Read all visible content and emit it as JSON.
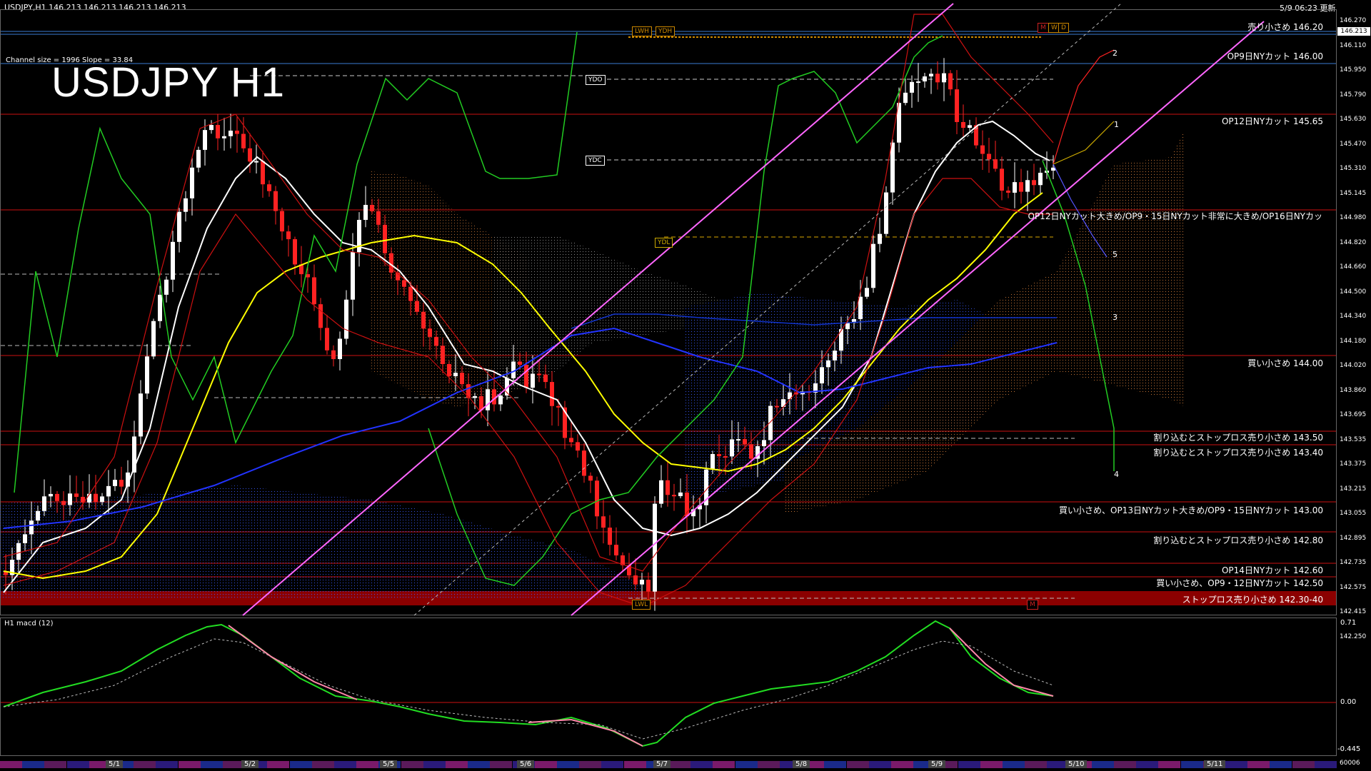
{
  "header": {
    "symbol_info": "USDJPY,H1  146.213 146.213 146.213 146.213",
    "updated": "5/9 06:23 更新",
    "channel_info": "Channel size = 1996 Slope = 33.84",
    "big_title": "USDJPY H1"
  },
  "sub_panel": {
    "label": "H1  macd (12)",
    "scale_top": "0.71",
    "scale_zero": "0.00",
    "scale_bottom": "-0.445"
  },
  "price_tag": "146.213",
  "price_scale": [
    "146.270",
    "146.110",
    "145.950",
    "145.790",
    "145.630",
    "145.470",
    "145.310",
    "145.145",
    "144.980",
    "144.820",
    "144.660",
    "144.500",
    "144.340",
    "144.180",
    "144.020",
    "143.860",
    "143.695",
    "143.535",
    "143.375",
    "143.215",
    "143.055",
    "142.895",
    "142.735",
    "142.575",
    "142.415",
    "142.250"
  ],
  "date_labels": [
    "5/1",
    "5/2",
    "5/5",
    "5/6",
    "5/7",
    "5/8",
    "5/9",
    "5/10",
    "5/11"
  ],
  "date_label_bottom_right": "60006",
  "level_tags": {
    "lwh": "LWH",
    "ydh": "YDH",
    "ydo": "YDO",
    "ydc": "YDC",
    "ydl": "YDL",
    "lwl": "LWL",
    "m": "M",
    "w": "W",
    "d": "D"
  },
  "wave_labels": [
    "1",
    "2",
    "3",
    "4",
    "5"
  ],
  "annotations": [
    {
      "text": "売り小さめ 146.20",
      "color": "#1e90ff"
    },
    {
      "text": "OP9日NYカット 146.00",
      "color": "#1e90ff"
    },
    {
      "text": "OP12日NYカット 145.65",
      "color": "#cc0000"
    },
    {
      "text": "OP12日NYカット大きめ/OP9・15日NYカット非常に大きめ/OP16日NYカッ",
      "color": "#cc0000"
    },
    {
      "text": "買い小さめ 144.00",
      "color": "#cc0000"
    },
    {
      "text": "割り込むとストップロス売り小さめ 143.50",
      "color": "#cc0000"
    },
    {
      "text": "割り込むとストップロス売り小さめ 143.40",
      "color": "#cc0000"
    },
    {
      "text": "買い小さめ、OP13日NYカット大きめ/OP9・15日NYカット 143.00",
      "color": "#cc0000"
    },
    {
      "text": "割り込むとストップロス売り小さめ 142.80",
      "color": "#cc0000"
    },
    {
      "text": "OP14日NYカット 142.60",
      "color": "#cc0000"
    },
    {
      "text": "買い小さめ、OP9・12日NYカット 142.50",
      "color": "#cc0000"
    },
    {
      "text": "ストップロス売り小さめ 142.30-40",
      "color": "#cc0000"
    }
  ]
}
